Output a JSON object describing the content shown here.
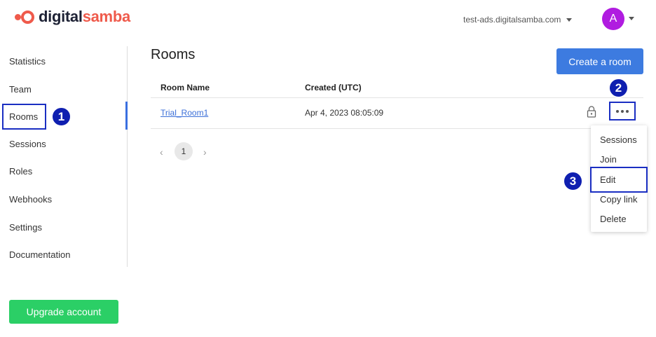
{
  "brand": {
    "name_part1": "digital",
    "name_part2": "samba",
    "accent": "#ef5a4b"
  },
  "header": {
    "domain": "test-ads.digitalsamba.com",
    "avatar_initial": "A",
    "avatar_color": "#b01ce0"
  },
  "sidebar": {
    "items": [
      {
        "label": "Statistics"
      },
      {
        "label": "Team"
      },
      {
        "label": "Rooms",
        "active": true
      },
      {
        "label": "Sessions"
      },
      {
        "label": "Roles"
      },
      {
        "label": "Webhooks"
      },
      {
        "label": "Settings"
      },
      {
        "label": "Documentation"
      }
    ],
    "upgrade_label": "Upgrade account"
  },
  "main": {
    "title": "Rooms",
    "create_label": "Create a room",
    "table": {
      "columns": [
        "Room Name",
        "Created (UTC)"
      ],
      "rows": [
        {
          "name": "Trial_Room1",
          "created": "Apr 4, 2023 08:05:09",
          "locked": true
        }
      ]
    },
    "pagination": {
      "prev": "‹",
      "current": "1",
      "next": "›"
    }
  },
  "row_menu": {
    "items": [
      "Sessions",
      "Join",
      "Edit",
      "Copy link",
      "Delete"
    ]
  },
  "annotations": {
    "step1": "1",
    "step2": "2",
    "step3": "3"
  },
  "colors": {
    "primary": "#3d7be0",
    "success": "#2bcf66",
    "annotation": "#0f1fb0"
  }
}
